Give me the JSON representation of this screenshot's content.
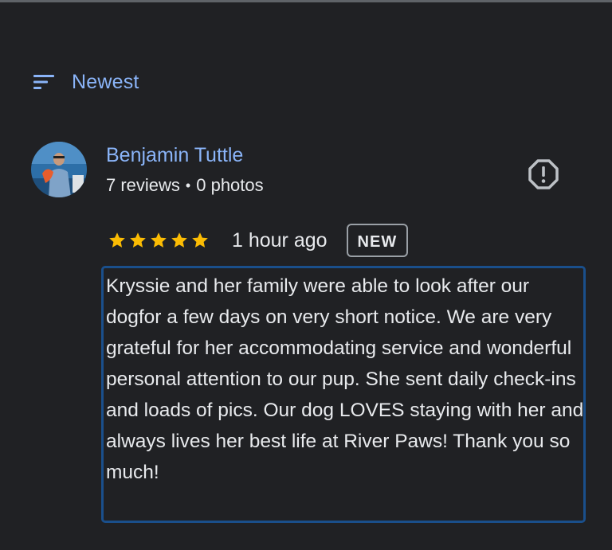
{
  "sort": {
    "label": "Newest",
    "icon": "sort-icon"
  },
  "review": {
    "reviewer_name": "Benjamin Tuttle",
    "review_count": "7 reviews",
    "meta_separator": "•",
    "photo_count": "0 photos",
    "rating": 5,
    "max_rating": 5,
    "time": "1 hour ago",
    "badge": "NEW",
    "text": "Kryssie and her family were able to look after our dogfor a few days on very short notice. We are very grateful for her accommodating service and wonderful personal attention to our pup. She sent daily check-ins and loads of pics. Our dog LOVES staying with her and always lives her best life at River Paws! Thank you so much!"
  },
  "colors": {
    "background": "#202124",
    "accent": "#8ab4f8",
    "text": "#e8eaed",
    "star": "#fbbc04",
    "selection_border": "#1a4f8b"
  }
}
